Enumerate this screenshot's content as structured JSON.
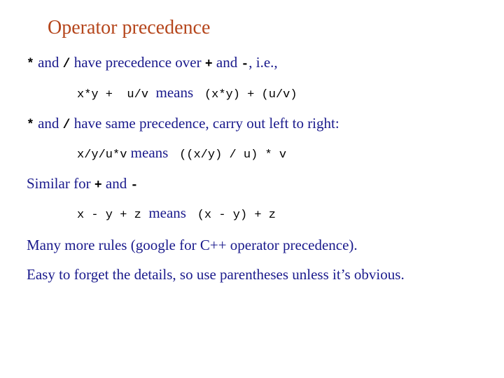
{
  "slide": {
    "title": "Operator precedence",
    "colors": {
      "title": "#b5461c",
      "text": "#1a1a8c",
      "code": "#000000",
      "background": "#ffffff"
    },
    "rule1": {
      "op1": "*",
      "and1": " and ",
      "op2": "/",
      "text1": " have precedence over ",
      "op3": "+",
      "and2": " and ",
      "op4": "-",
      "text2": ", i.e.,"
    },
    "example1": {
      "expr": "x*y +  u/v",
      "means": "means",
      "result": "(x*y) + (u/v)"
    },
    "rule2": {
      "op1": "*",
      "and1": " and ",
      "op2": "/",
      "text1": " have same precedence, carry out left to right:"
    },
    "example2": {
      "expr": "x/y/u*v",
      "means": "means",
      "result": "((x/y) / u) * v"
    },
    "rule3": {
      "text1": "Similar for ",
      "op1": "+",
      "and1": " and ",
      "op2": "-"
    },
    "example3": {
      "expr": "x - y + z",
      "means": "means",
      "result": "(x - y) + z"
    },
    "note1": "Many more rules (google for C++ operator precedence).",
    "note2": "Easy to forget the details, so use parentheses unless it’s obvious."
  }
}
